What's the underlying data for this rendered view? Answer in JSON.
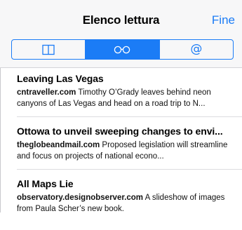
{
  "header": {
    "title": "Elenco lettura",
    "done_label": "Fine"
  },
  "segments": [
    {
      "name": "bookmarks",
      "icon": "book-icon"
    },
    {
      "name": "reading-list",
      "icon": "glasses-icon",
      "active": true
    },
    {
      "name": "shared-links",
      "icon": "at-icon",
      "glyph": "@"
    }
  ],
  "items": [
    {
      "title": "Leaving Las Vegas",
      "domain": "cntraveller.com",
      "snippet": "Timothy O’Grady leaves behind neon canyons of Las Vegas and head on a road trip to N..."
    },
    {
      "title": "Ottowa to unveil sweeping changes to envi...",
      "domain": "theglobeandmail.com",
      "snippet": "Proposed legislation will streamline and focus on projects of national econo..."
    },
    {
      "title": "All Maps Lie",
      "domain": "observatory.designobserver.com",
      "snippet": "A slideshow of images from Paula Scher’s new book."
    }
  ],
  "colors": {
    "accent": "#1b7cf6",
    "navbar_bg": "#f7f7f8"
  }
}
